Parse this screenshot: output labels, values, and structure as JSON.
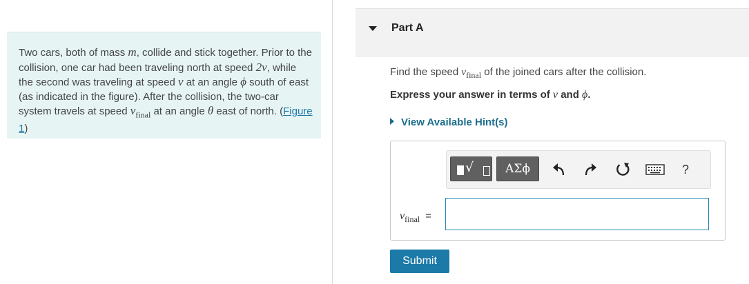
{
  "problem": {
    "text_1": "Two cars, both of mass ",
    "var_m": "m",
    "text_2": ", collide and stick together. Prior to the collision, one car had been traveling north at speed ",
    "var_2v": "2v",
    "text_3": ", while the second was traveling at speed ",
    "var_v": "v",
    "text_4": " at an angle ",
    "var_phi": "ϕ",
    "text_5": " south of east (as indicated in the figure). After the collision, the two-car system travels at speed ",
    "var_vfinal": "v",
    "var_vfinal_sub": "final",
    "text_6": " at an angle ",
    "var_theta": "θ",
    "text_7": " east of north. (",
    "figure_link": "Figure 1",
    "text_8": ")"
  },
  "part": {
    "title": "Part A"
  },
  "question": {
    "text_1": "Find the speed ",
    "var": "v",
    "var_sub": "final",
    "text_2": " of the joined cars after the collision."
  },
  "instruction": {
    "text_1": "Express your answer in terms of ",
    "var_v": "v",
    "text_2": " and ",
    "var_phi": "ϕ",
    "text_3": "."
  },
  "hints": {
    "label": "View Available Hint(s)"
  },
  "toolbar": {
    "greek_label": "ΑΣϕ",
    "help_label": "?",
    "radical_glyph": "√"
  },
  "answer": {
    "var": "v",
    "var_sub": "final",
    "equals": "=",
    "value": ""
  },
  "submit": {
    "label": "Submit"
  }
}
